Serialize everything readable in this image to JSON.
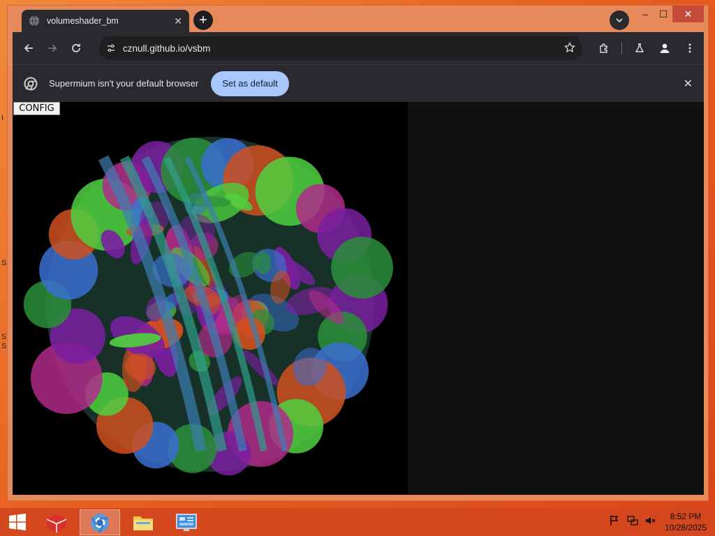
{
  "desktop": {
    "glyphs": [
      "I",
      "S",
      "S",
      "S"
    ]
  },
  "browser": {
    "tab": {
      "title": "volumeshader_bm",
      "close_glyph": "✕"
    },
    "new_tab_glyph": "+",
    "window_controls": {
      "minimize": "–",
      "maximize": "☐",
      "close": "✕"
    },
    "url": "cznull.github.io/vsbm",
    "infobar": {
      "message": "Supermium isn't your default browser",
      "button": "Set as default",
      "dismiss": "✕"
    }
  },
  "page": {
    "config_button": "CONFIG",
    "fractal_palette": [
      "#7a1fa0",
      "#2a8f3a",
      "#3a6fd0",
      "#d0501f",
      "#4fd040",
      "#b02a8a"
    ]
  },
  "taskbar": {
    "apps": [
      {
        "name": "Application",
        "icon": "red-app-icon"
      },
      {
        "name": "Browser",
        "icon": "browser-icon",
        "active": true
      },
      {
        "name": "File Explorer",
        "icon": "folder-icon"
      },
      {
        "name": "Control Panel",
        "icon": "control-panel-icon"
      }
    ],
    "clock": {
      "time": "8:52 PM",
      "date": "10/28/2025"
    }
  },
  "colors": {
    "accent": "#a8c7fa",
    "window_frame": "#e8895c",
    "toolbar": "#2a2a2e",
    "taskbar": "#d2461e"
  }
}
